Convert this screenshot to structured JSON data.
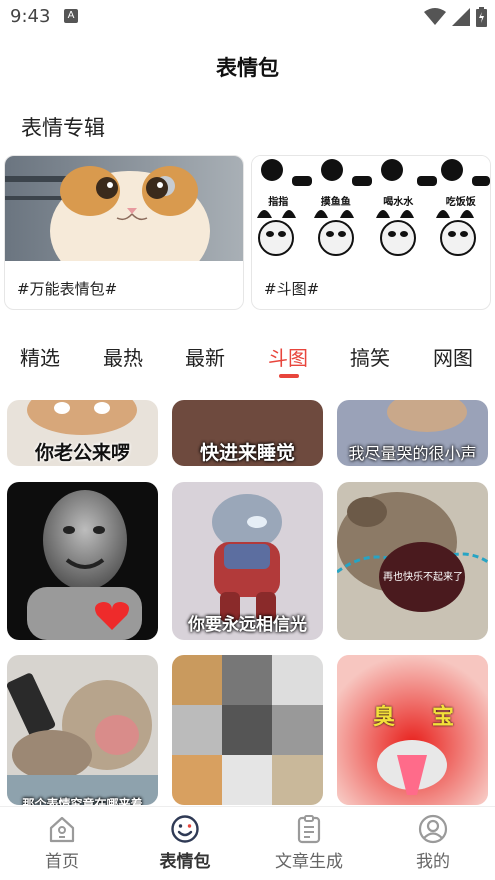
{
  "status_bar": {
    "time": "9:43",
    "notification_glyph": "A"
  },
  "header": {
    "title": "表情包"
  },
  "albums": {
    "section_title": "表情专辑",
    "items": [
      {
        "label": "#万能表情包#"
      },
      {
        "label": "#斗图#"
      }
    ],
    "doutu_captions": [
      "指指",
      "摸鱼鱼",
      "喝水水",
      "吃饭饭"
    ]
  },
  "tabs": [
    {
      "label": "精选"
    },
    {
      "label": "最热"
    },
    {
      "label": "最新"
    },
    {
      "label": "斗图",
      "active": true
    },
    {
      "label": "搞笑"
    },
    {
      "label": "网图"
    }
  ],
  "grid": {
    "row1": [
      "你老公来啰",
      "快进来睡觉",
      "我尽量哭的很小声"
    ],
    "row2_bubble": "再也快乐不起来了",
    "row2_caption": "你要永远相信光",
    "row3_caption": "那个表情究竟在哪来着",
    "row3_big": [
      "臭",
      "宝"
    ]
  },
  "bottom_nav": [
    {
      "label": "首页",
      "icon": "home-icon"
    },
    {
      "label": "表情包",
      "icon": "smile-icon",
      "active": true
    },
    {
      "label": "文章生成",
      "icon": "document-icon"
    },
    {
      "label": "我的",
      "icon": "profile-icon"
    }
  ],
  "colors": {
    "accent": "#e8453c",
    "nav_active": "#2f3a55",
    "nav_inactive": "#9a9a9a"
  }
}
